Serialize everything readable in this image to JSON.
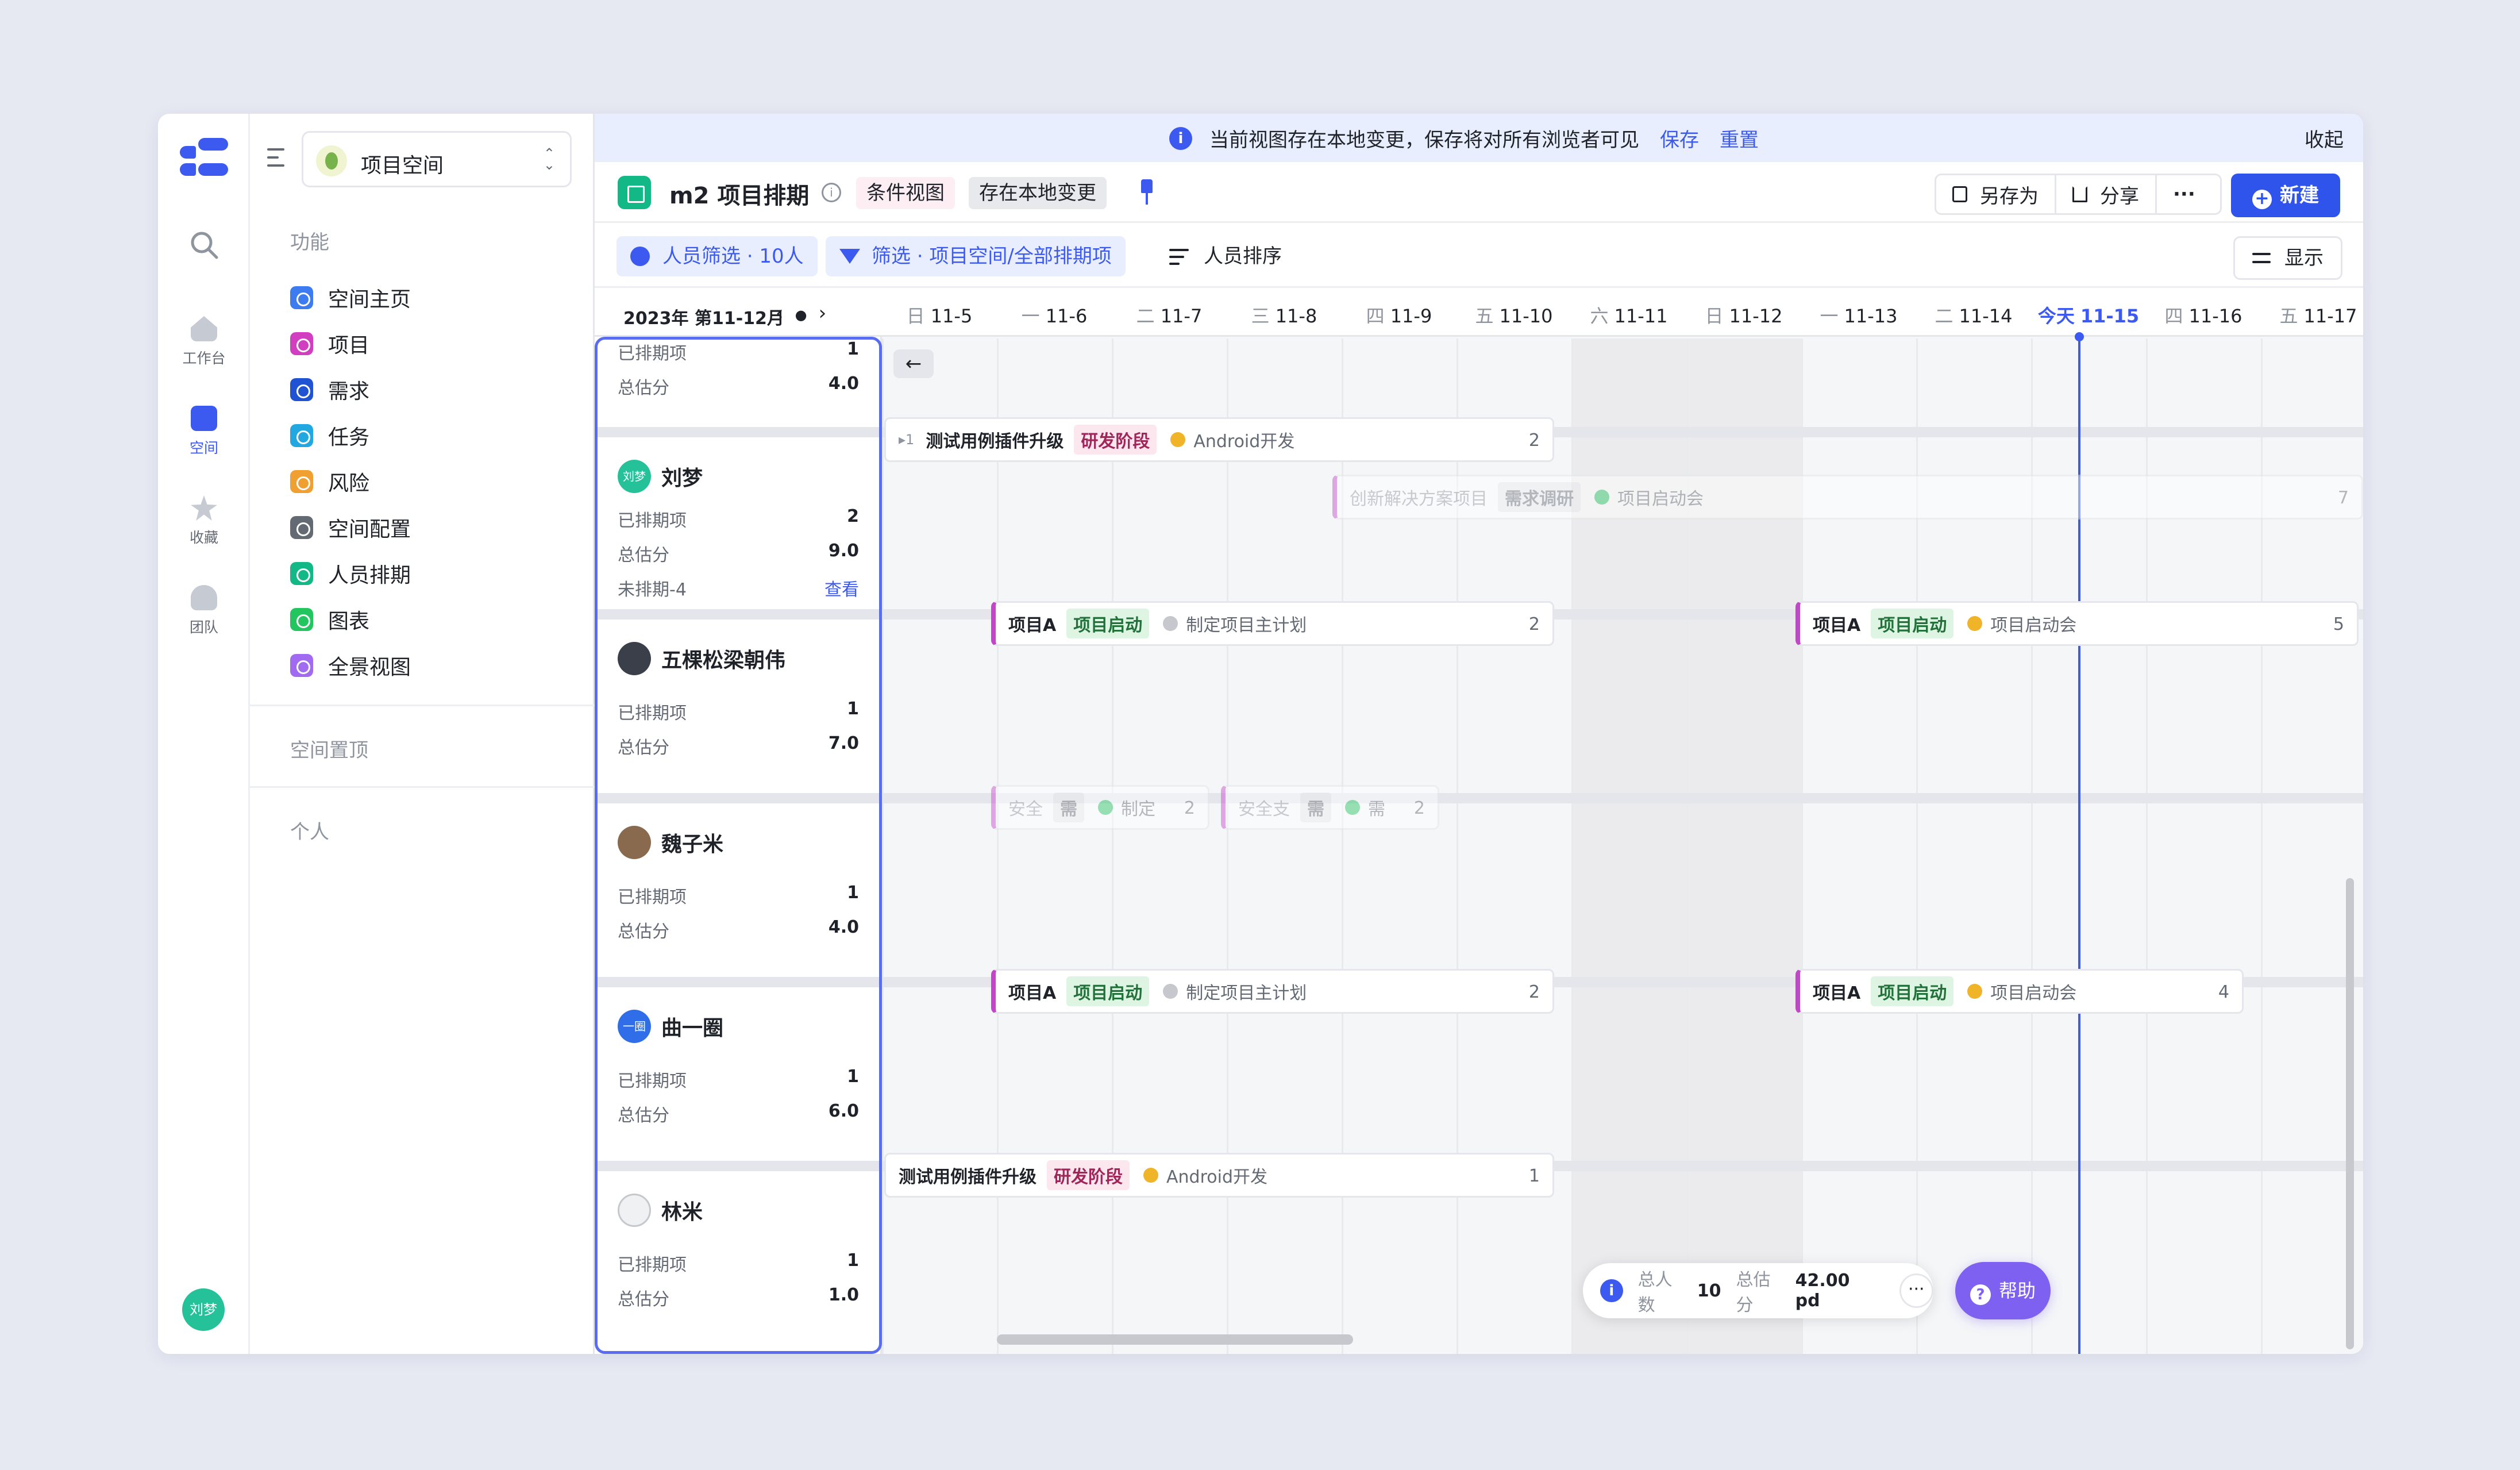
{
  "rail": {
    "items": [
      {
        "label": "工作台",
        "icon": "home-icon"
      },
      {
        "label": "空间",
        "icon": "space-icon"
      },
      {
        "label": "收藏",
        "icon": "star-icon"
      },
      {
        "label": "团队",
        "icon": "team-icon"
      }
    ],
    "user_avatar": "刘梦"
  },
  "sidebar": {
    "space_name": "项目空间",
    "section_features": "功能",
    "items": [
      {
        "label": "空间主页",
        "color": "#3c7bf0"
      },
      {
        "label": "项目",
        "color": "#d23ec0"
      },
      {
        "label": "需求",
        "color": "#2053d4"
      },
      {
        "label": "任务",
        "color": "#22a8e0"
      },
      {
        "label": "风险",
        "color": "#f0a030"
      },
      {
        "label": "空间配置",
        "color": "#646a73"
      },
      {
        "label": "人员排期",
        "color": "#12b886"
      },
      {
        "label": "图表",
        "color": "#22c55e"
      },
      {
        "label": "全景视图",
        "color": "#a06bf0"
      }
    ],
    "section_pinned": "空间置顶",
    "section_personal": "个人"
  },
  "banner": {
    "message": "当前视图存在本地变更，保存将对所有浏览者可见",
    "save": "保存",
    "reset": "重置",
    "collapse": "收起"
  },
  "toolbar": {
    "title": "m2 项目排期",
    "tag_view": "条件视图",
    "tag_local": "存在本地变更",
    "save_as": "另存为",
    "share": "分享",
    "more": "···",
    "new": "新建"
  },
  "filters": {
    "people": "人员筛选 · 10人",
    "filter": "筛选 · 项目空间/全部排期项",
    "sort": "人员排序",
    "display": "显示"
  },
  "calendar": {
    "month": "2023年 第11-12月",
    "days": [
      {
        "wk": "日",
        "d": "11-5"
      },
      {
        "wk": "一",
        "d": "11-6"
      },
      {
        "wk": "二",
        "d": "11-7"
      },
      {
        "wk": "三",
        "d": "11-8"
      },
      {
        "wk": "四",
        "d": "11-9"
      },
      {
        "wk": "五",
        "d": "11-10"
      },
      {
        "wk": "六",
        "d": "11-11"
      },
      {
        "wk": "日",
        "d": "11-12"
      },
      {
        "wk": "一",
        "d": "11-13"
      },
      {
        "wk": "二",
        "d": "11-14"
      },
      {
        "wk": "今天",
        "d": "11-15"
      },
      {
        "wk": "四",
        "d": "11-16"
      },
      {
        "wk": "五",
        "d": "11-17"
      }
    ]
  },
  "people": [
    {
      "name": "",
      "stats": [
        {
          "k": "已排期项",
          "v": "1"
        },
        {
          "k": "总估分",
          "v": "4.0"
        }
      ]
    },
    {
      "name": "刘梦",
      "avatar": "刘梦",
      "stats": [
        {
          "k": "已排期项",
          "v": "2"
        },
        {
          "k": "总估分",
          "v": "9.0"
        },
        {
          "k": "未排期-4",
          "v": "查看"
        }
      ]
    },
    {
      "name": "五棵松梁朝伟",
      "stats": [
        {
          "k": "已排期项",
          "v": "1"
        },
        {
          "k": "总估分",
          "v": "7.0"
        }
      ]
    },
    {
      "name": "魏子米",
      "stats": [
        {
          "k": "已排期项",
          "v": "1"
        },
        {
          "k": "总估分",
          "v": "4.0"
        }
      ]
    },
    {
      "name": "曲一圈",
      "avatar": "一圈",
      "stats": [
        {
          "k": "已排期项",
          "v": "1"
        },
        {
          "k": "总估分",
          "v": "6.0"
        }
      ]
    },
    {
      "name": "林米",
      "stats": [
        {
          "k": "已排期项",
          "v": "1"
        },
        {
          "k": "总估分",
          "v": "1.0"
        }
      ]
    }
  ],
  "bars": [
    {
      "expand": "▸1",
      "name": "测试用例插件升级",
      "stage": "研发阶段",
      "dot": "#f0b429",
      "status": "Android开发",
      "count": "2"
    },
    {
      "name": "创新解决方案项目",
      "stage": "需求调研",
      "dot": "#22c55e",
      "status": "项目启动会",
      "count": "7"
    },
    {
      "name": "项目A",
      "stage": "项目启动",
      "dot": "#c6c8cd",
      "status": "制定项目主计划",
      "count": "2"
    },
    {
      "name": "项目A",
      "stage": "项目启动",
      "dot": "#f0b429",
      "status": "项目启动会",
      "count": "5"
    },
    {
      "name": "安全",
      "stage": "需",
      "dot": "#22c55e",
      "status": "制定",
      "count": "2"
    },
    {
      "name": "安全支",
      "stage": "需",
      "dot": "#22c55e",
      "status": "需",
      "count": "2"
    },
    {
      "name": "项目A",
      "stage": "项目启动",
      "dot": "#c6c8cd",
      "status": "制定项目主计划",
      "count": "2"
    },
    {
      "name": "项目A",
      "stage": "项目启动",
      "dot": "#f0b429",
      "status": "项目启动会",
      "count": "4"
    },
    {
      "name": "测试用例插件升级",
      "stage": "研发阶段",
      "dot": "#f0b429",
      "status": "Android开发",
      "count": "1"
    }
  ],
  "summary": {
    "people_label": "总人数",
    "people_value": "10",
    "estimate_label": "总估分",
    "estimate_value": "42.00 pd",
    "more": "···"
  },
  "help": "帮助",
  "colors": {
    "accent": "#3c5af0",
    "today": "#3c5af0",
    "help": "#7e61f0"
  }
}
